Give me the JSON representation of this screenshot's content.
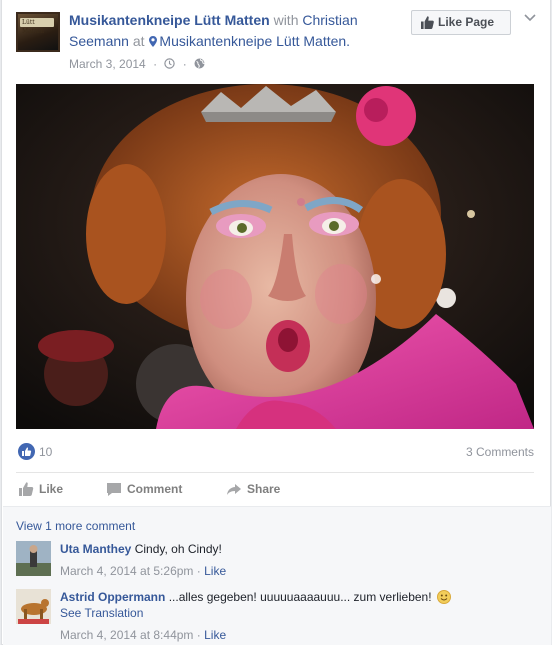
{
  "post": {
    "page_name": "Musikantenkneipe Lütt Matten",
    "with_word": "with",
    "tagged_person": "Christian Seemann",
    "at_word": "at",
    "location": "Musikantenkneipe Lütt Matten.",
    "date": "March 3, 2014",
    "like_page_label": "Like Page"
  },
  "stats": {
    "likes": "10",
    "comments": "3 Comments"
  },
  "actions": {
    "like": "Like",
    "comment": "Comment",
    "share": "Share"
  },
  "comments": {
    "view_more": "View 1 more comment",
    "items": [
      {
        "name": "Uta Manthey",
        "text": "Cindy, oh Cindy!",
        "time": "March 4, 2014 at 5:26pm",
        "like": "Like"
      },
      {
        "name": "Astrid Oppermann",
        "text": "...alles gegeben! uuuuuaaaauuu... zum verlieben!",
        "see_translation": "See Translation",
        "time": "March 4, 2014 at 8:44pm",
        "like": "Like"
      }
    ]
  },
  "colors": {
    "link": "#365899",
    "muted": "#90949c",
    "like_blue": "#4267b2"
  },
  "icons": {
    "location": "map-pin-icon",
    "clock": "clock-icon",
    "audience": "globe-icon",
    "like_page": "thumbs-up-icon",
    "menu": "chevron-down-icon",
    "smiley": "smiley-emoji-icon"
  }
}
